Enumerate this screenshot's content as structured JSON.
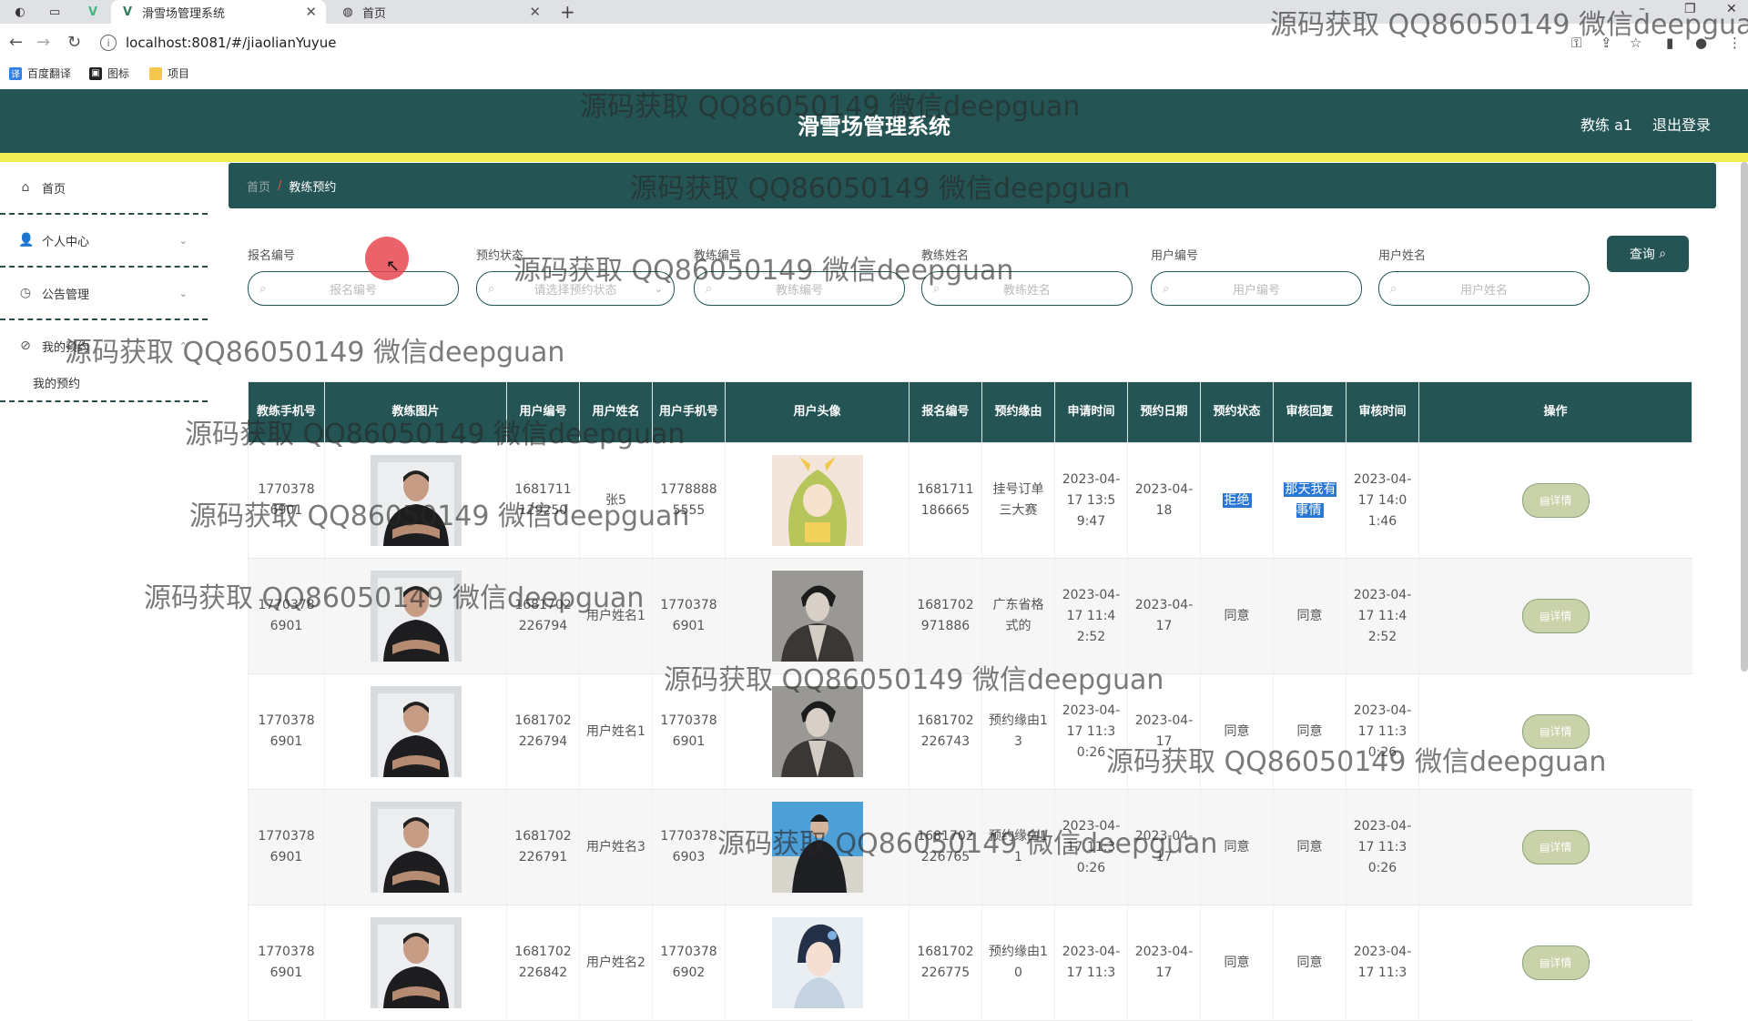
{
  "browser": {
    "tabs": [
      {
        "title": "滑雪场管理系统",
        "active": true
      },
      {
        "title": "首页",
        "active": false
      }
    ],
    "url": "localhost:8081/#/jiaolianYuyue",
    "bookmarks": [
      "百度翻译",
      "图标",
      "项目"
    ]
  },
  "header": {
    "title": "滑雪场管理系统",
    "user": "教练 a1",
    "logout": "退出登录"
  },
  "sidebar": {
    "items": [
      {
        "label": "首页",
        "icon": "home-icon"
      },
      {
        "label": "个人中心",
        "icon": "user-icon"
      },
      {
        "label": "公告管理",
        "icon": "clock-icon"
      },
      {
        "label": "我的预约",
        "icon": "compass-icon"
      }
    ],
    "subitem": "我的预约"
  },
  "breadcrumb": {
    "home": "首页",
    "separator": "/",
    "current": "教练预约"
  },
  "filters": [
    {
      "label": "报名编号",
      "placeholder": "报名编号"
    },
    {
      "label": "预约状态",
      "placeholder": "请选择预约状态"
    },
    {
      "label": "教练编号",
      "placeholder": "教练编号"
    },
    {
      "label": "教练姓名",
      "placeholder": "教练姓名"
    },
    {
      "label": "用户编号",
      "placeholder": "用户编号"
    },
    {
      "label": "用户姓名",
      "placeholder": "用户姓名"
    }
  ],
  "query_button": "查询",
  "table": {
    "headers": [
      "教练手机号",
      "教练图片",
      "用户编号",
      "用户姓名",
      "用户手机号",
      "用户头像",
      "报名编号",
      "预约缘由",
      "申请时间",
      "预约日期",
      "预约状态",
      "审核回复",
      "审核时间",
      "操作"
    ],
    "detail_label": "详情",
    "rows": [
      [
        "17703786901",
        "",
        "1681711129250",
        "张5",
        "17788885555",
        "",
        "1681711186665",
        "挂号订单三大赛",
        "2023-04-17 13:59:47",
        "2023-04-18",
        "拒绝",
        "那天我有事情",
        "2023-04-17 14:01:46"
      ],
      [
        "17703786901",
        "",
        "1681702226794",
        "用户姓名1",
        "17703786901",
        "",
        "1681702971886",
        "广东省格式的",
        "2023-04-17 11:42:52",
        "2023-04-17",
        "同意",
        "同意",
        "2023-04-17 11:42:52"
      ],
      [
        "17703786901",
        "",
        "1681702226794",
        "用户姓名1",
        "17703786901",
        "",
        "1681702226743",
        "预约缘由13",
        "2023-04-17 11:30:26",
        "2023-04-17",
        "同意",
        "同意",
        "2023-04-17 11:30:26"
      ],
      [
        "17703786901",
        "",
        "1681702226791",
        "用户姓名3",
        "17703786903",
        "",
        "1681702226765",
        "预约缘由11",
        "2023-04-17 11:30:26",
        "2023-04-17",
        "同意",
        "同意",
        "2023-04-17 11:30:26"
      ],
      [
        "17703786901",
        "",
        "1681702226842",
        "用户姓名2",
        "17703786902",
        "",
        "1681702226775",
        "预约缘由10",
        "2023-04-17 11:3",
        "2023-04-17",
        "同意",
        "同意",
        "2023-04-17 11:3"
      ]
    ]
  },
  "watermark": "源码获取 QQ86050149 微信deepguan",
  "colors": {
    "primary": "#245454",
    "accent_bar": "#f3ec53"
  }
}
